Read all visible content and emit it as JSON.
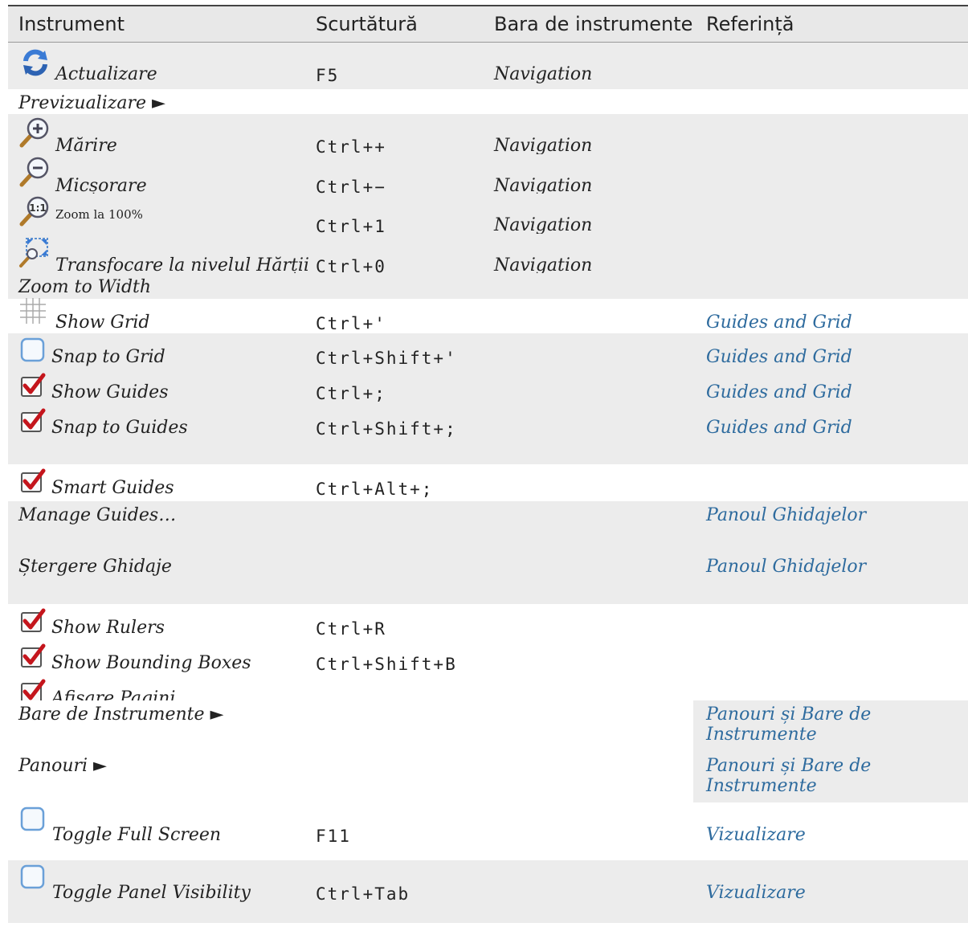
{
  "headers": {
    "instrument": "Instrument",
    "shortcut": "Scurtătură",
    "toolbar": "Bara de instrumente",
    "reference": "Referință"
  },
  "rows": [
    {
      "label": "Actualizare",
      "shortcut": "F5",
      "toolbar": "Navigation",
      "reference": "",
      "icon": "refresh-icon"
    },
    {
      "label": "Previzualizare ►",
      "shortcut": "",
      "toolbar": "",
      "reference": "",
      "icon": ""
    },
    {
      "label": "Mărire",
      "shortcut": "Ctrl++",
      "toolbar": "Navigation",
      "reference": "",
      "icon": "zoom-in-icon"
    },
    {
      "label": "Micșorare",
      "shortcut": "Ctrl+−",
      "toolbar": "Navigation",
      "reference": "",
      "icon": "zoom-out-icon"
    },
    {
      "label": "Zoom la 100%",
      "shortcut": "Ctrl+1",
      "toolbar": "Navigation",
      "reference": "",
      "icon": "zoom-actual-icon"
    },
    {
      "label": "Transfocare la nivelul Hărții",
      "shortcut": "Ctrl+0",
      "toolbar": "Navigation",
      "reference": "",
      "icon": "zoom-full-icon"
    },
    {
      "label": "Zoom to Width",
      "shortcut": "",
      "toolbar": "",
      "reference": "",
      "icon": ""
    },
    {
      "label": "Show Grid",
      "shortcut": "Ctrl+'",
      "toolbar": "",
      "reference": "Guides and Grid",
      "icon": "grid-icon"
    },
    {
      "label": "Snap to Grid",
      "shortcut": "Ctrl+Shift+'",
      "toolbar": "",
      "reference": "Guides and Grid",
      "icon": "checkbox-unchecked-icon"
    },
    {
      "label": "Show Guides",
      "shortcut": "Ctrl+;",
      "toolbar": "",
      "reference": "Guides and Grid",
      "icon": "checkbox-checked-icon"
    },
    {
      "label": "Snap to Guides",
      "shortcut": "Ctrl+Shift+;",
      "toolbar": "",
      "reference": "Guides and Grid",
      "icon": "checkbox-checked-icon"
    },
    {
      "label": "Smart Guides",
      "shortcut": "Ctrl+Alt+;",
      "toolbar": "",
      "reference": "",
      "icon": "checkbox-checked-icon"
    },
    {
      "label": "Manage Guides…",
      "shortcut": "",
      "toolbar": "",
      "reference": "Panoul Ghidajelor",
      "icon": ""
    },
    {
      "label": "Ștergere Ghidaje",
      "shortcut": "",
      "toolbar": "",
      "reference": "Panoul Ghidajelor",
      "icon": ""
    },
    {
      "label": "Show Rulers",
      "shortcut": "Ctrl+R",
      "toolbar": "",
      "reference": "",
      "icon": "checkbox-checked-icon"
    },
    {
      "label": "Show Bounding Boxes",
      "shortcut": "Ctrl+Shift+B",
      "toolbar": "",
      "reference": "",
      "icon": "checkbox-checked-icon"
    },
    {
      "label": "Afișare Pagini",
      "shortcut": "",
      "toolbar": "",
      "reference": "",
      "icon": "checkbox-checked-icon"
    },
    {
      "label": "Bare de Instrumente ►",
      "shortcut": "",
      "toolbar": "",
      "reference": "Panouri și Bare de Instrumente",
      "icon": ""
    },
    {
      "label": "Panouri ►",
      "shortcut": "",
      "toolbar": "",
      "reference": "Panouri și Bare de Instrumente",
      "icon": ""
    },
    {
      "label": "Toggle Full Screen",
      "shortcut": "F11",
      "toolbar": "",
      "reference": "Vizualizare",
      "icon": "checkbox-unchecked-icon"
    },
    {
      "label": "Toggle Panel Visibility",
      "shortcut": "Ctrl+Tab",
      "toolbar": "",
      "reference": "Vizualizare",
      "icon": "checkbox-unchecked-icon"
    }
  ]
}
